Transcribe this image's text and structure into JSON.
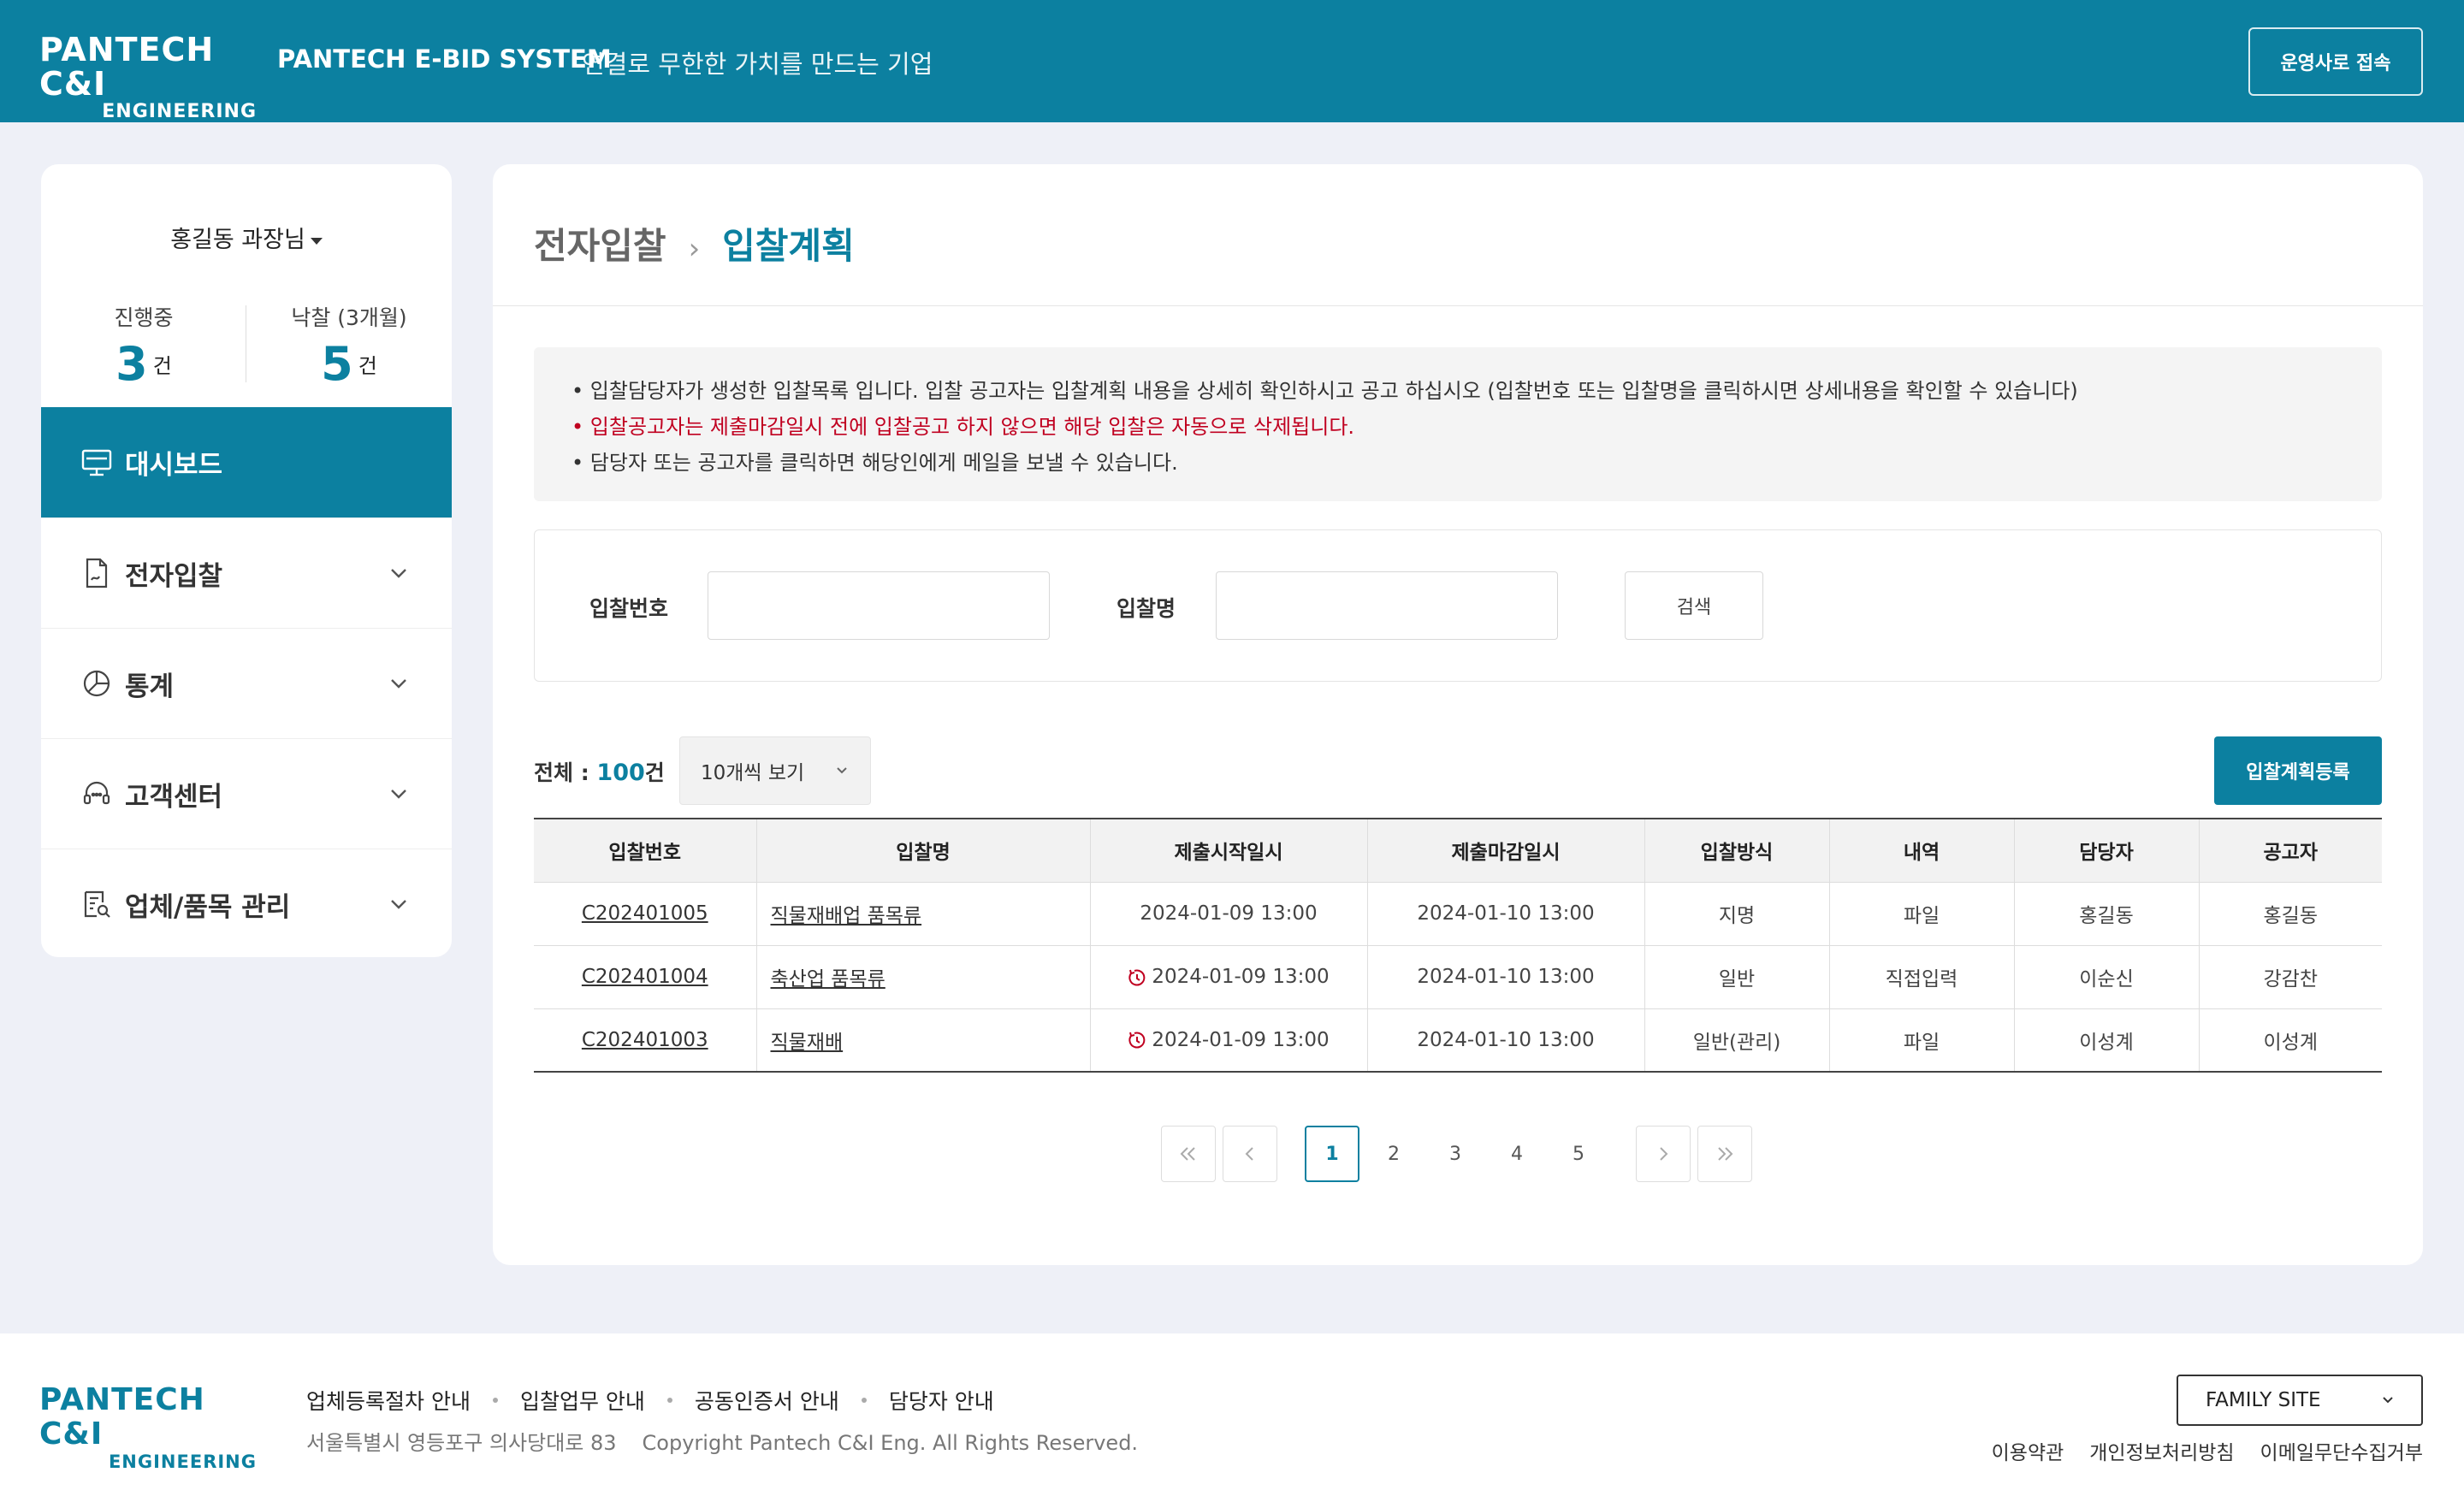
{
  "header": {
    "logo_line1": "PANTECH C&I",
    "logo_line2": "ENGINEERING",
    "system_name": "PANTECH E-BID SYSTEM",
    "slogan": "연결로 무한한 가치를 만드는 기업",
    "operator_button": "운영사로 접속",
    "bg_color": "#0c80a0"
  },
  "sidebar": {
    "user": "홍길동 과장님",
    "stats": [
      {
        "label": "진행중",
        "value": "3",
        "unit": "건"
      },
      {
        "label": "낙찰 (3개월)",
        "value": "5",
        "unit": "건"
      }
    ],
    "menu": [
      {
        "label": "대시보드",
        "icon": "monitor-icon"
      },
      {
        "label": "전자입찰",
        "icon": "document-icon"
      },
      {
        "label": "통계",
        "icon": "pie-chart-icon"
      },
      {
        "label": "고객센터",
        "icon": "headset-icon"
      },
      {
        "label": "업체/품목 관리",
        "icon": "list-search-icon"
      }
    ]
  },
  "breadcrumb": {
    "parent": "전자입찰",
    "current": "입찰계획"
  },
  "notice": {
    "line1": "입찰담당자가 생성한 입찰목록 입니다. 입찰 공고자는 입찰계획 내용을 상세히 확인하시고 공고 하십시오 (입찰번호 또는 입찰명을 클릭하시면 상세내용을 확인할 수 있습니다)",
    "line2": "입찰공고자는 제출마감일시 전에 입찰공고 하지 않으면 해당 입찰은 자동으로 삭제됩니다.",
    "line3": "담당자 또는 공고자를 클릭하면 해당인에게 메일을 보낼 수 있습니다."
  },
  "search": {
    "bid_no_label": "입찰번호",
    "bid_no_value": "",
    "bid_name_label": "입찰명",
    "bid_name_value": "",
    "button": "검색"
  },
  "list": {
    "total_label": "전체 :",
    "total_count": "100",
    "total_unit": "건",
    "per_page": "10개씩 보기",
    "register_button": "입찰계획등록",
    "columns": [
      "입찰번호",
      "입찰명",
      "제출시작일시",
      "제출마감일시",
      "입찰방식",
      "내역",
      "담당자",
      "공고자"
    ],
    "rows": [
      {
        "no": "C202401005",
        "name": "직물재배업 품목류",
        "start": "2024-01-09 13:00",
        "end": "2024-01-10 13:00",
        "method": "지명",
        "detail": "파일",
        "manager": "홍길동",
        "announcer": "홍길동",
        "late": false
      },
      {
        "no": "C202401004",
        "name": "축산업 품목류",
        "start": "2024-01-09 13:00",
        "end": "2024-01-10 13:00",
        "method": "일반",
        "detail": "직접입력",
        "manager": "이순신",
        "announcer": "강감찬",
        "late": true
      },
      {
        "no": "C202401003",
        "name": "직물재배",
        "start": "2024-01-09 13:00",
        "end": "2024-01-10 13:00",
        "method": "일반(관리)",
        "detail": "파일",
        "manager": "이성계",
        "announcer": "이성계",
        "late": true
      }
    ]
  },
  "pagination": {
    "pages": [
      "1",
      "2",
      "3",
      "4",
      "5"
    ],
    "current": "1"
  },
  "footer": {
    "logo_line1": "PANTECH C&I",
    "logo_line2": "ENGINEERING",
    "links": [
      "업체등록절차 안내",
      "입찰업무 안내",
      "공동인증서 안내",
      "담당자 안내"
    ],
    "address": "서울특별시 영등포구 의사당대로 83",
    "copyright": "Copyright Pantech C&I Eng. All Rights Reserved.",
    "family_site": "FAMILY SITE",
    "policies": [
      "이용약관",
      "개인정보처리방침",
      "이메일무단수집거부"
    ]
  }
}
